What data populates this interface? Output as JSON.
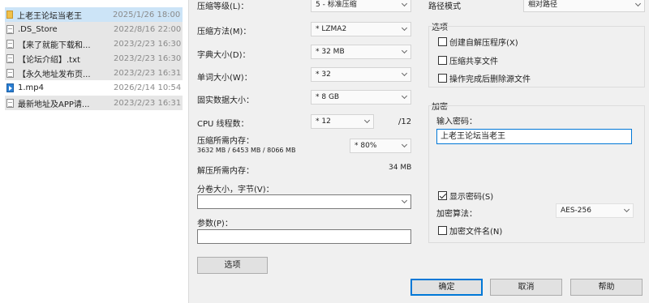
{
  "files": [
    {
      "name": "上老王论坛当老王",
      "date": "2025/1/26 18:00",
      "icon": "folder-icon",
      "selected": true
    },
    {
      "name": ".DS_Store",
      "date": "2022/8/16 22:00",
      "icon": "file-icon",
      "selected": false
    },
    {
      "name": "【来了就能下载和...",
      "date": "2023/2/23 16:30",
      "icon": "file-icon",
      "selected": false
    },
    {
      "name": "【论坛介绍】.txt",
      "date": "2023/2/23 16:30",
      "icon": "file-icon",
      "selected": false
    },
    {
      "name": "【永久地址发布页...",
      "date": "2023/2/23 16:31",
      "icon": "file-icon",
      "selected": false
    },
    {
      "name": "1.mp4",
      "date": "2026/2/14 10:54",
      "icon": "video-file-icon",
      "selected": false
    },
    {
      "name": "最新地址及APP请...",
      "date": "2023/2/23 16:31",
      "icon": "file-icon",
      "selected": false
    }
  ],
  "left": {
    "compression_level_label": "压缩等级(L)：",
    "compression_level_value": "5 - 标准压缩",
    "compression_method_label": "压缩方法(M)：",
    "compression_method_value": "* LZMA2",
    "dictionary_size_label": "字典大小(D)：",
    "dictionary_size_value": "* 32 MB",
    "word_size_label": "单词大小(W)：",
    "word_size_value": "* 32",
    "solid_block_label": "固实数据大小：",
    "solid_block_value": "* 8 GB",
    "cpu_threads_label": "CPU 线程数：",
    "cpu_threads_value": "* 12",
    "cpu_threads_total": "/12",
    "mem_compress_label": "压缩所需内存：",
    "mem_compress_detail": "3632 MB / 6453 MB / 8066 MB",
    "mem_percent_value": "* 80%",
    "mem_decompress_label": "解压所需内存：",
    "mem_decompress_value": "34 MB",
    "split_label": "分卷大小，字节(V)：",
    "params_label": "参数(P)：",
    "options_button": "选项"
  },
  "right": {
    "path_mode_label": "路径模式",
    "path_mode_value": "相对路径",
    "options_group_label": "选项",
    "create_sfx_label": "创建自解压程序(X)",
    "compress_shared_label": "压缩共享文件",
    "delete_after_label": "操作完成后删除源文件",
    "encryption_group_label": "加密",
    "password_label": "输入密码：",
    "password_value": "上老王论坛当老王",
    "show_password_label": "显示密码(S)",
    "encryption_method_label": "加密算法：",
    "encryption_method_value": "AES-256",
    "encrypt_names_label": "加密文件名(N)"
  },
  "buttons": {
    "ok": "确定",
    "cancel": "取消",
    "help": "帮助"
  }
}
